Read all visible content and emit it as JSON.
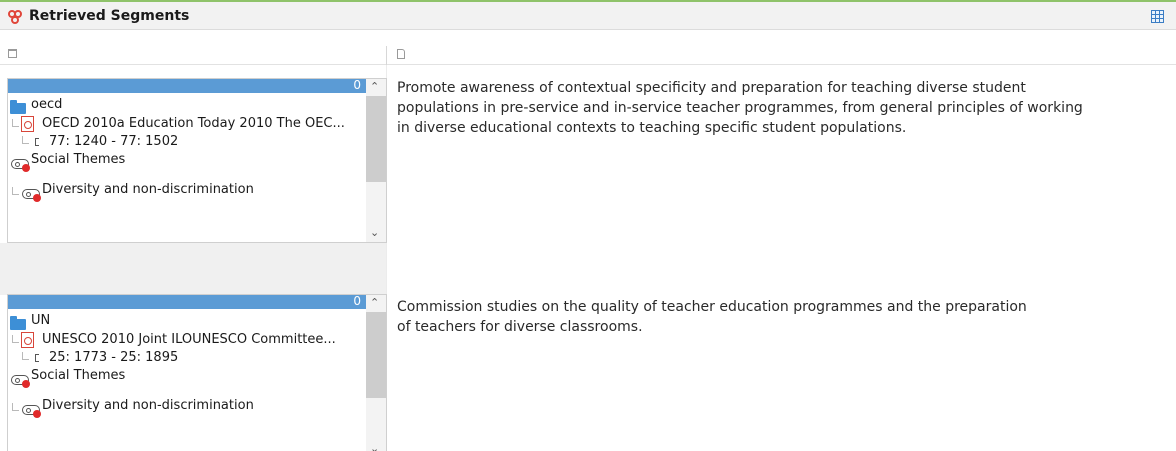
{
  "header": {
    "title": "Retrieved Segments",
    "logo_icon": "segments-logo-icon",
    "view_icon": "table-grid-icon",
    "accent_color": "#8fc36a"
  },
  "segments": [
    {
      "count": "0",
      "folder": "oecd",
      "document": "OECD 2010a Education Today 2010 The OEC...",
      "range": "77: 1240 - 77: 1502",
      "code_group": "Social Themes",
      "code": "Diversity and non-discrimination",
      "text": "Promote awareness of contextual specificity and preparation for teaching diverse student\npopulations in pre-service and in-service teacher programmes, from general principles of working\nin diverse educational contexts to teaching specific student populations."
    },
    {
      "count": "0",
      "folder": "UN",
      "document": "UNESCO 2010 Joint ILOUNESCO Committee...",
      "range": "25: 1773 - 25: 1895",
      "code_group": "Social Themes",
      "code": "Diversity and non-discrimination",
      "text": "Commission studies on the quality of teacher education programmes and the preparation\nof teachers for diverse classrooms."
    }
  ]
}
